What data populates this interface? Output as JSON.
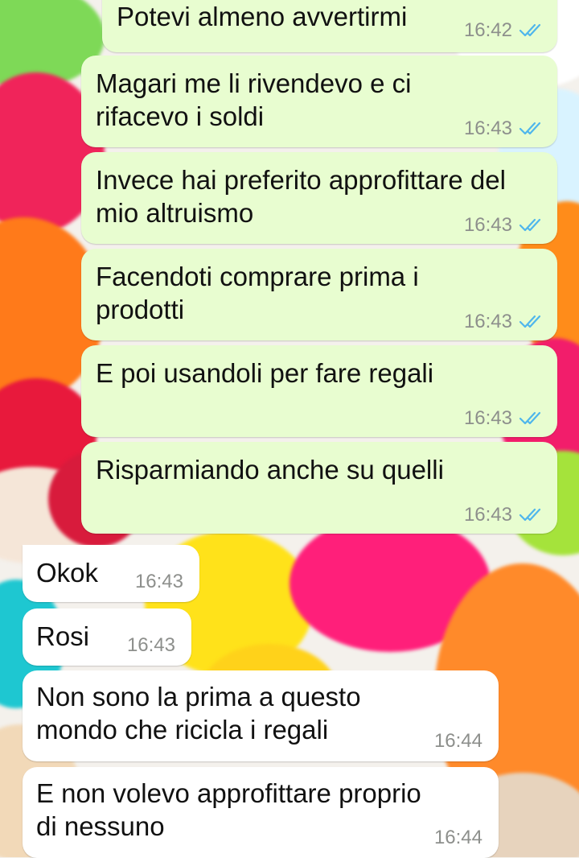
{
  "chat": {
    "messages": [
      {
        "direction": "outgoing",
        "text": "Potevi almeno avvertirmi",
        "time": "16:42",
        "status": "read"
      },
      {
        "direction": "outgoing",
        "text": "Magari me li rivendevo e ci\nrifacevo i soldi",
        "time": "16:43",
        "status": "read"
      },
      {
        "direction": "outgoing",
        "text": "Invece hai preferito approfittare del\nmio altruismo",
        "time": "16:43",
        "status": "read"
      },
      {
        "direction": "outgoing",
        "text": "Facendoti comprare prima i\nprodotti",
        "time": "16:43",
        "status": "read"
      },
      {
        "direction": "outgoing",
        "text": "E poi usandoli per fare regali",
        "time": "16:43",
        "status": "read"
      },
      {
        "direction": "outgoing",
        "text": "Risparmiando anche su quelli",
        "time": "16:43",
        "status": "read"
      },
      {
        "direction": "incoming",
        "text": "Okok",
        "time": "16:43"
      },
      {
        "direction": "incoming",
        "text": "Rosi",
        "time": "16:43"
      },
      {
        "direction": "incoming",
        "text": "Non sono la prima a questo\nmondo che ricicla i regali",
        "time": "16:44"
      },
      {
        "direction": "incoming",
        "text": "E non volevo approfittare proprio\ndi nessuno",
        "time": "16:44"
      }
    ]
  },
  "colors": {
    "outgoing_bubble": "#e8fdd0",
    "incoming_bubble": "#ffffff",
    "read_tick": "#4fb6ec",
    "timestamp": "#8d8f8c"
  },
  "icons": {
    "read_receipt": "double-check-icon"
  }
}
